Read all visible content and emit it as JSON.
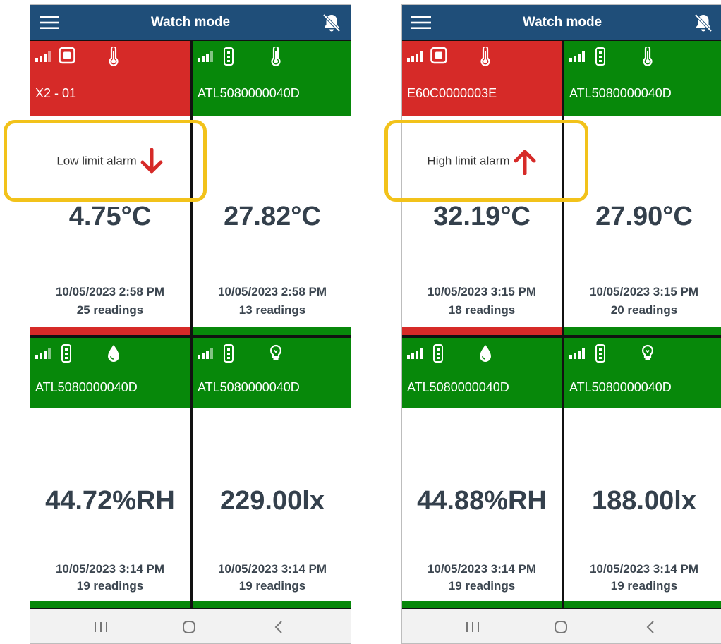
{
  "app": {
    "title": "Watch mode"
  },
  "colors": {
    "appbar": "#1f4e79",
    "alarm_red": "#d62a28",
    "ok_green": "#07880a",
    "highlight": "#f2c21a"
  },
  "icons": {
    "menu": "hamburger-menu-icon",
    "bell": "bell-off-icon",
    "signal": "signal-bars-icon",
    "temperature": "thermometer-icon",
    "humidity": "droplet-icon",
    "light": "lightbulb-icon",
    "logger": "logger-device-icon",
    "back": "back-chevron-icon",
    "home": "home-circle-icon",
    "recents": "recents-icon"
  },
  "screens": [
    {
      "tiles": [
        {
          "device_id": "X2 - 01",
          "status": "alarm",
          "sensor": "temperature",
          "alarm_label": "Low limit alarm",
          "alarm_direction": "down",
          "value": "4.75°C",
          "timestamp": "10/05/2023 2:58 PM",
          "readings": "25 readings"
        },
        {
          "device_id": "ATL5080000040D",
          "status": "ok",
          "sensor": "temperature",
          "value": "27.82°C",
          "timestamp": "10/05/2023 2:58 PM",
          "readings": "13 readings"
        },
        {
          "device_id": "ATL5080000040D",
          "status": "ok",
          "sensor": "humidity",
          "value": "44.72%RH",
          "timestamp": "10/05/2023 3:14 PM",
          "readings": "19 readings"
        },
        {
          "device_id": "ATL5080000040D",
          "status": "ok",
          "sensor": "light",
          "value": "229.00lx",
          "timestamp": "10/05/2023 3:14 PM",
          "readings": "19 readings"
        }
      ]
    },
    {
      "tiles": [
        {
          "device_id": "E60C0000003E",
          "status": "alarm",
          "sensor": "temperature",
          "alarm_label": "High limit alarm",
          "alarm_direction": "up",
          "value": "32.19°C",
          "timestamp": "10/05/2023 3:15 PM",
          "readings": "18 readings"
        },
        {
          "device_id": "ATL5080000040D",
          "status": "ok",
          "sensor": "temperature",
          "value": "27.90°C",
          "timestamp": "10/05/2023 3:15 PM",
          "readings": "20 readings"
        },
        {
          "device_id": "ATL5080000040D",
          "status": "ok",
          "sensor": "humidity",
          "value": "44.88%RH",
          "timestamp": "10/05/2023 3:14 PM",
          "readings": "19 readings"
        },
        {
          "device_id": "ATL5080000040D",
          "status": "ok",
          "sensor": "light",
          "value": "188.00lx",
          "timestamp": "10/05/2023 3:14 PM",
          "readings": "19 readings"
        }
      ]
    }
  ]
}
